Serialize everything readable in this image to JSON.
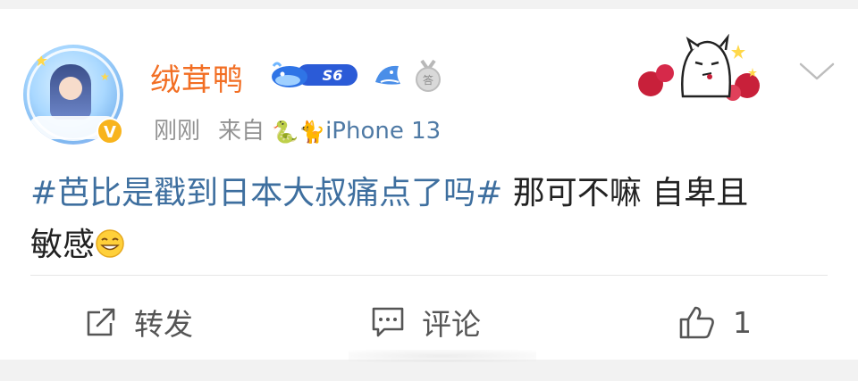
{
  "post": {
    "username": "绒茸鸭",
    "level_badge": "S6",
    "time": "刚刚",
    "source_prefix": "来自",
    "source_emoji_1": "🐍",
    "source_emoji_2": "🐈",
    "device": "iPhone 13",
    "hashtag": "#芭比是戳到日本大叔痛点了吗#",
    "text_line1_rest": " 那可不嘛 自卑且",
    "text_line2": "敏感"
  },
  "actions": {
    "repost_label": "转发",
    "comment_label": "评论",
    "like_count": "1"
  },
  "colors": {
    "username": "#f26e23",
    "hashtag": "#3e6f9f",
    "device": "#4f7aa5",
    "meta": "#939393",
    "text": "#222222",
    "verified": "#f8b41d"
  },
  "icons": {
    "more": "chevron-down-icon",
    "repost": "repost-icon",
    "comment": "comment-icon",
    "like": "thumbs-up-icon",
    "verified": "verified-v-icon"
  }
}
